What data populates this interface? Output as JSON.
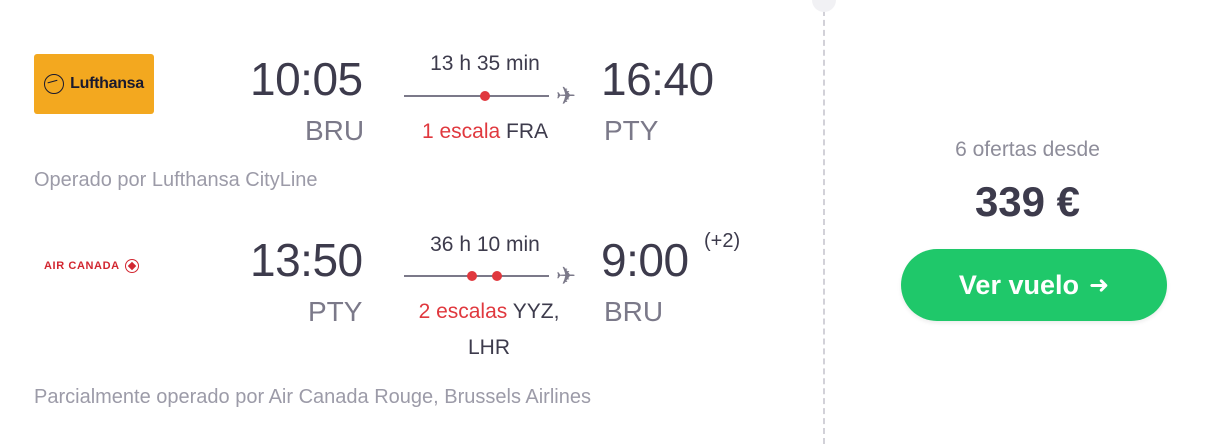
{
  "flights": [
    {
      "airline_logo_text": "Lufthansa",
      "depart_time": "10:05",
      "depart_code": "BRU",
      "duration": "13 h 35 min",
      "stops_label": "1 escala",
      "stops_airports": "FRA",
      "arrive_time": "16:40",
      "arrive_code": "PTY",
      "plus_days": "",
      "operated_by": "Operado por Lufthansa CityLine",
      "stop_count": 1
    },
    {
      "airline_logo_text": "AIR CANADA",
      "depart_time": "13:50",
      "depart_code": "PTY",
      "duration": "36 h 10 min",
      "stops_label": "2 escalas",
      "stops_airports": "YYZ,",
      "stops_airports_line2": "LHR",
      "arrive_time": "9:00",
      "arrive_code": "BRU",
      "plus_days": "(+2)",
      "operated_by": "Parcialmente operado por Air Canada Rouge, Brussels Airlines",
      "stop_count": 2
    }
  ],
  "offer": {
    "offers_text": "6 ofertas desde",
    "price": "339 €",
    "button_label": "Ver vuelo",
    "button_color": "#1fc86a"
  },
  "colors": {
    "stop_red": "#e0383e",
    "text_dark": "#3d3b4c",
    "text_muted": "#9c9ba8",
    "lufthansa_yellow": "#f3a81f",
    "air_canada_red": "#d22630"
  }
}
